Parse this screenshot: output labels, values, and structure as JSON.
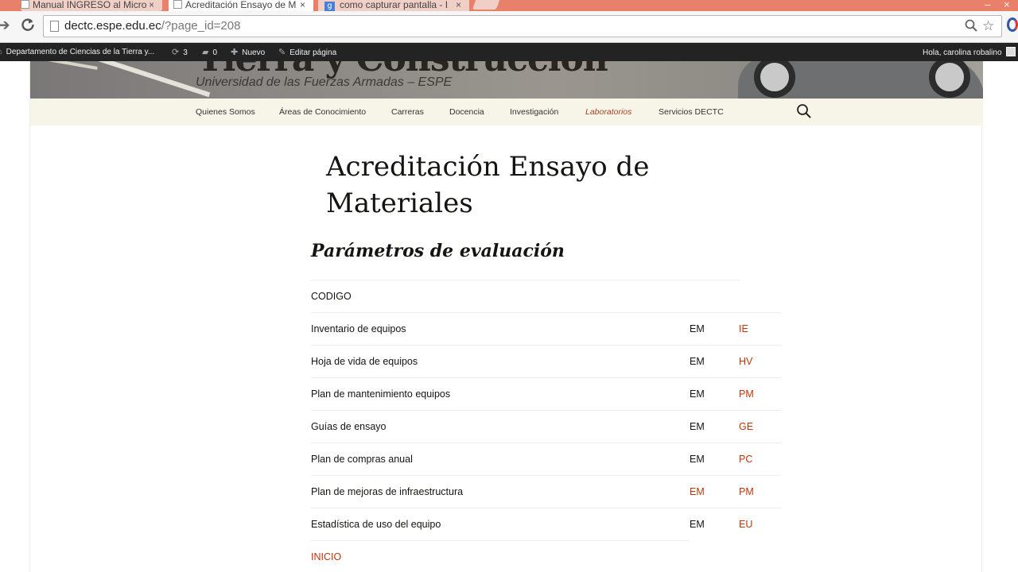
{
  "browser": {
    "tabs": [
      {
        "title": "Manual INGRESO al Micro",
        "close": "×"
      },
      {
        "title": "Acreditación Ensayo de M",
        "close": "×"
      },
      {
        "title": "como capturar pantalla - I",
        "close": "×"
      }
    ],
    "window_controls": {
      "minimize": "–",
      "close": "×"
    },
    "url_host": "dectc.espe.edu.ec",
    "url_path": "/?page_id=208",
    "icons": [
      "back-arrow",
      "reload",
      "page",
      "search",
      "star",
      "extension"
    ]
  },
  "adminbar": {
    "site_name": "Departamento de Ciencias de la Tierra y...",
    "updates_count": "3",
    "comments_count": "0",
    "new_label": "Nuevo",
    "edit_label": "Editar página",
    "greeting": "Hola, carolina robalino"
  },
  "header": {
    "site_title": "Tierra y Construcción",
    "site_description": "Universidad de las Fuerzas Armadas – ESPE"
  },
  "nav": {
    "items": [
      {
        "label": "Quienes Somos"
      },
      {
        "label": "Áreas de Conocimiento"
      },
      {
        "label": "Carreras"
      },
      {
        "label": "Docencia"
      },
      {
        "label": "Investigación"
      },
      {
        "label": "Laboratorios",
        "active": true
      },
      {
        "label": "Servicios DECTC"
      }
    ]
  },
  "article": {
    "title": "Acreditación Ensayo de Materiales",
    "section_title": "Parámetros de evaluación",
    "table_header": "CODIGO",
    "rows": [
      {
        "name": "Inventario de equipos",
        "code1": "EM",
        "code2": "IE"
      },
      {
        "name": "Hoja de vida de equipos",
        "code1": "EM",
        "code2": "HV"
      },
      {
        "name": "Plan de mantenimiento equipos",
        "code1": "EM",
        "code2": "PM"
      },
      {
        "name": "Guías de ensayo",
        "code1": "EM",
        "code2": "GE"
      },
      {
        "name": "Plan de compras anual",
        "code1": "EM",
        "code2": "PC"
      },
      {
        "name": "Plan de mejoras de infraestructura",
        "code1": "EM",
        "code2": "PM"
      },
      {
        "name": "Estadística de uso del equipo",
        "code1": "EM",
        "code2": "EU"
      }
    ],
    "footer_link": "INICIO"
  },
  "colors": {
    "tabstrip": "#e8806a",
    "adminbar": "#232323",
    "navbar": "#f7f5e7",
    "link": "#bc360a",
    "active_nav": "#a44427"
  }
}
